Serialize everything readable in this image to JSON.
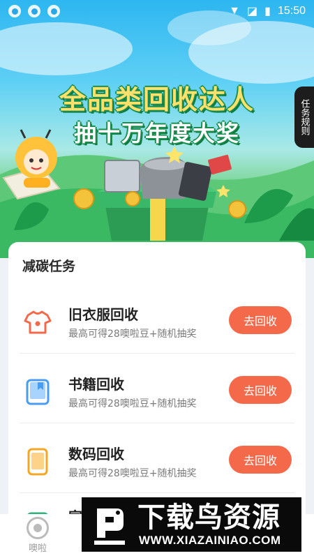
{
  "status_bar": {
    "time": "15:50"
  },
  "banner": {
    "title_line1": "全品类回收达人",
    "title_line2": "抽十万年度大奖",
    "rules_button": "任务规则"
  },
  "task_section": {
    "title": "减碳任务",
    "tasks": [
      {
        "name": "旧衣服回收",
        "desc": "最高可得28噢啦豆+随机抽奖",
        "button": "去回收",
        "icon": "tshirt-icon"
      },
      {
        "name": "书籍回收",
        "desc": "最高可得28噢啦豆+随机抽奖",
        "button": "去回收",
        "icon": "book-icon"
      },
      {
        "name": "数码回收",
        "desc": "最高可得28噢啦豆+随机抽奖",
        "button": "去回收",
        "icon": "phone-icon"
      },
      {
        "name": "家",
        "icon": "appliance-icon"
      }
    ]
  },
  "tab_bar": {
    "items": [
      {
        "label": "噢啦",
        "icon": "olla-icon"
      }
    ]
  },
  "watermark": {
    "text": "下载鸟资源",
    "url": "WWW.XIAZAINIAO.COM"
  },
  "colors": {
    "accent": "#f4694a",
    "banner_green": "#2fb25a",
    "sky": "#2db6f0"
  }
}
